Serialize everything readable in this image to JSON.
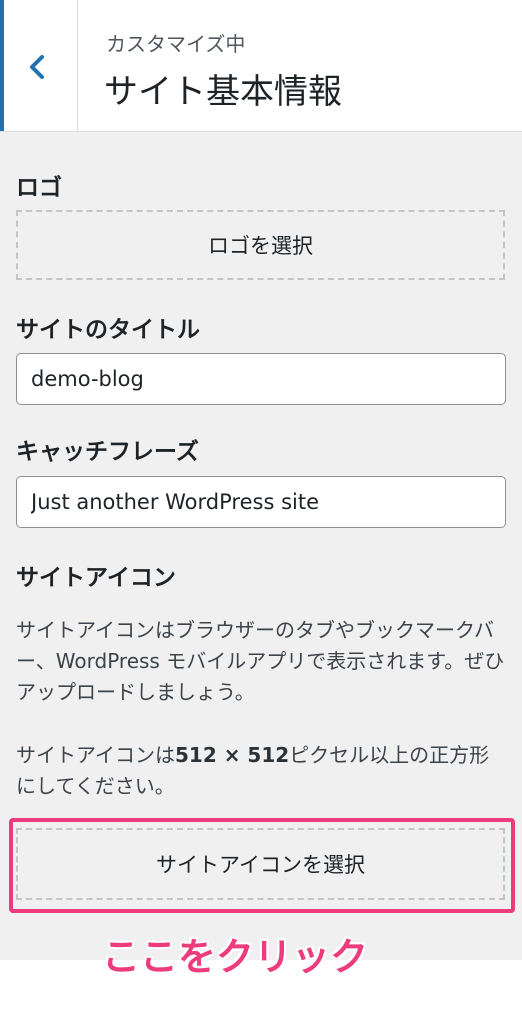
{
  "header": {
    "back_label": "戻る",
    "subtitle": "カスタマイズ中",
    "title": "サイト基本情報"
  },
  "logo": {
    "label": "ロゴ",
    "select_button": "ロゴを選択"
  },
  "site_title": {
    "label": "サイトのタイトル",
    "value": "demo-blog"
  },
  "tagline": {
    "label": "キャッチフレーズ",
    "value": "Just another WordPress site"
  },
  "site_icon": {
    "label": "サイトアイコン",
    "description": "サイトアイコンはブラウザーのタブやブックマークバー、WordPress モバイルアプリで表示されます。ぜひアップロードしましょう。",
    "size_note_prefix": "サイトアイコンは",
    "size_note_size": "512 × 512",
    "size_note_suffix": "ピクセル以上の正方形にしてください。",
    "select_button": "サイトアイコンを選択"
  },
  "annotation": {
    "text": "ここをクリック",
    "color": "#ec3c7e"
  },
  "colors": {
    "accent": "#2271b1",
    "panel_bg": "#f0f0f1",
    "highlight": "#ec3c7e"
  }
}
